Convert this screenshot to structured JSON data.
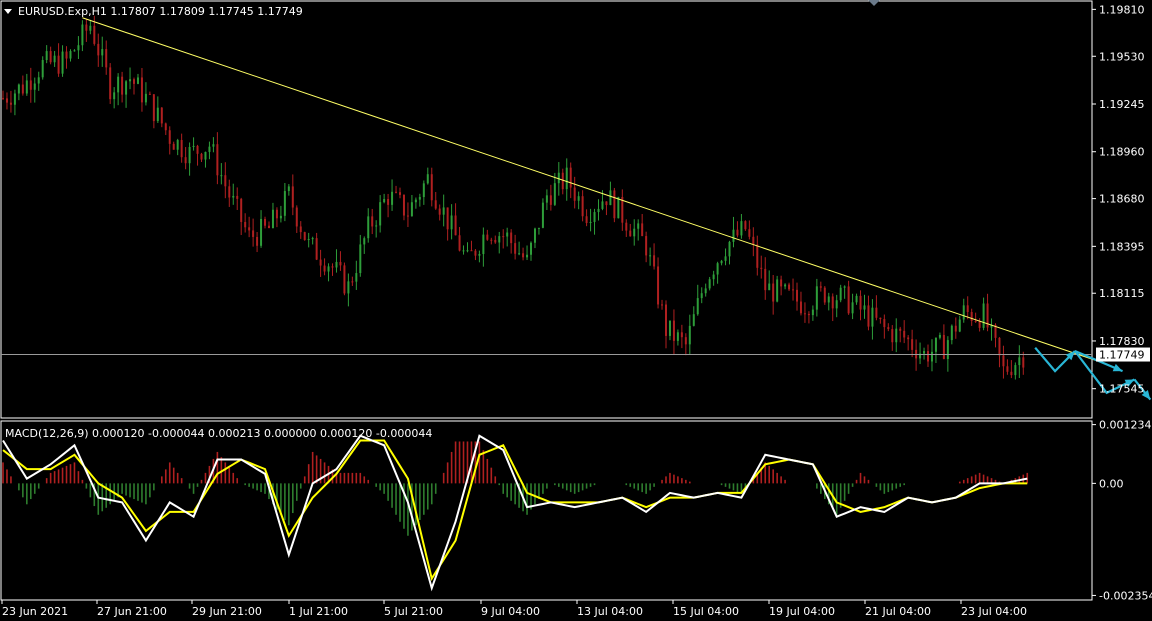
{
  "header": {
    "symbol_line": "EURUSD.Exp,H1  1.17807 1.17809 1.17745 1.17749",
    "macd_line": "MACD(12,26,9) 0.000120 -0.000044 0.000213 0.000000 0.000120 -0.000044"
  },
  "colors": {
    "background": "#000000",
    "frame": "#ffffff",
    "bull_candle": "#2e9e3a",
    "bear_candle": "#b02020",
    "trendline": "#ffff66",
    "price_line": "#9a9a9a",
    "macd_line": "#ffffff",
    "signal_line": "#ffff00",
    "hist_positive": "#b02020",
    "hist_negative": "#2e7d2e",
    "arrow": "#29b6d6",
    "price_tag_bg": "#ffffff",
    "price_tag_text": "#000000"
  },
  "chart_data": [
    {
      "type": "line",
      "title": "EURUSD.Exp,H1",
      "price_axis_ticks": [
        "1.19810",
        "1.19530",
        "1.19245",
        "1.18960",
        "1.18680",
        "1.18395",
        "1.18115",
        "1.17830",
        "1.17545"
      ],
      "price_axis_values": [
        1.1981,
        1.1953,
        1.19245,
        1.1896,
        1.1868,
        1.18395,
        1.18115,
        1.1783,
        1.17545
      ],
      "ylim": [
        1.1737,
        1.1986
      ],
      "current_price": 1.17749,
      "current_price_label": "1.17749",
      "time_axis_ticks": [
        "23 Jun 2021",
        "27 Jun 21:00",
        "29 Jun 21:00",
        "1 Jul 21:00",
        "5 Jul 21:00",
        "9 Jul 04:00",
        "13 Jul 04:00",
        "15 Jul 04:00",
        "19 Jul 04:00",
        "21 Jul 04:00",
        "23 Jul 04:00"
      ],
      "close_path": {
        "bar_index": [
          0,
          5,
          10,
          16,
          22,
          27,
          32,
          37,
          42,
          47,
          52,
          57,
          62,
          67,
          72,
          77,
          82,
          87,
          92,
          97,
          102,
          107,
          112,
          117,
          122,
          127,
          132,
          137,
          142,
          147,
          152,
          157,
          162,
          167,
          172,
          177,
          182,
          187,
          192,
          197,
          202,
          207,
          212,
          217,
          222,
          227,
          232,
          237,
          242,
          247,
          252,
          257
        ],
        "close": [
          1.1928,
          1.1935,
          1.1948,
          1.195,
          1.1972,
          1.1935,
          1.194,
          1.1925,
          1.1905,
          1.1895,
          1.19,
          1.187,
          1.1845,
          1.185,
          1.187,
          1.184,
          1.183,
          1.1815,
          1.185,
          1.187,
          1.186,
          1.188,
          1.1855,
          1.183,
          1.185,
          1.1845,
          1.183,
          1.187,
          1.188,
          1.186,
          1.187,
          1.1855,
          1.184,
          1.179,
          1.178,
          1.182,
          1.184,
          1.185,
          1.1815,
          1.181,
          1.1805,
          1.1812,
          1.1808,
          1.18,
          1.179,
          1.1785,
          1.1775,
          1.178,
          1.18,
          1.1798,
          1.1765,
          1.1775
        ]
      },
      "trendline": {
        "from": {
          "bar_index": 20,
          "price": 1.1976
        },
        "to": {
          "bar_index": 277,
          "price": 1.177
        }
      },
      "projection_arrows": [
        {
          "bar_index": [
            260,
            265,
            270
          ],
          "price": [
            1.1779,
            1.1765,
            1.1777
          ]
        },
        {
          "bar_index": [
            270,
            278,
            285
          ],
          "price": [
            1.1777,
            1.1752,
            1.176
          ]
        },
        {
          "bar_index": [
            285,
            289
          ],
          "price": [
            1.176,
            1.1748
          ]
        },
        {
          "bar_index": [
            270,
            282
          ],
          "price": [
            1.1777,
            1.1765
          ]
        }
      ]
    },
    {
      "type": "line",
      "title": "MACD(12,26,9)",
      "axis_ticks": [
        "0.001234",
        "0.00",
        "-0.002354"
      ],
      "axis_values": [
        0.001234,
        0.0,
        -0.002354
      ],
      "ylim": [
        -0.00245,
        0.00131
      ],
      "series": [
        {
          "name": "MACD",
          "bar_index": [
            0,
            6,
            12,
            18,
            24,
            30,
            36,
            42,
            48,
            54,
            60,
            66,
            72,
            78,
            84,
            90,
            96,
            102,
            108,
            114,
            120,
            126,
            132,
            138,
            144,
            150,
            156,
            162,
            168,
            174,
            180,
            186,
            192,
            198,
            204,
            210,
            216,
            222,
            228,
            234,
            240,
            246,
            252,
            258
          ],
          "values": [
            0.0009,
            0.0001,
            0.0004,
            0.0008,
            -0.0003,
            -0.0004,
            -0.0012,
            -0.0004,
            -0.0007,
            0.0005,
            0.0005,
            0.0002,
            -0.0015,
            0.0,
            0.0003,
            0.001,
            0.0008,
            -0.0004,
            -0.0022,
            -0.0008,
            0.001,
            0.0007,
            -0.0005,
            -0.0004,
            -0.0005,
            -0.0004,
            -0.0003,
            -0.0006,
            -0.0002,
            -0.0003,
            -0.0002,
            -0.0003,
            0.0006,
            0.0005,
            0.0004,
            -0.0007,
            -0.0005,
            -0.0006,
            -0.0003,
            -0.0004,
            -0.0003,
            0.0,
            0.0,
            0.0001
          ]
        },
        {
          "name": "Signal",
          "bar_index": [
            0,
            6,
            12,
            18,
            24,
            30,
            36,
            42,
            48,
            54,
            60,
            66,
            72,
            78,
            84,
            90,
            96,
            102,
            108,
            114,
            120,
            126,
            132,
            138,
            144,
            150,
            156,
            162,
            168,
            174,
            180,
            186,
            192,
            198,
            204,
            210,
            216,
            222,
            228,
            234,
            240,
            246,
            252,
            258
          ],
          "values": [
            0.0007,
            0.0003,
            0.0003,
            0.0006,
            0.0,
            -0.0003,
            -0.001,
            -0.0006,
            -0.0006,
            0.0002,
            0.0005,
            0.0003,
            -0.0011,
            -0.0003,
            0.0002,
            0.0009,
            0.0009,
            0.0001,
            -0.002,
            -0.0012,
            0.0006,
            0.0008,
            -0.0002,
            -0.0004,
            -0.0004,
            -0.0004,
            -0.0003,
            -0.0005,
            -0.0003,
            -0.0003,
            -0.0002,
            -0.0002,
            0.0004,
            0.0005,
            0.0004,
            -0.0004,
            -0.0006,
            -0.0005,
            -0.0003,
            -0.0004,
            -0.0003,
            -0.0001,
            0.0,
            0.0
          ]
        }
      ]
    }
  ]
}
